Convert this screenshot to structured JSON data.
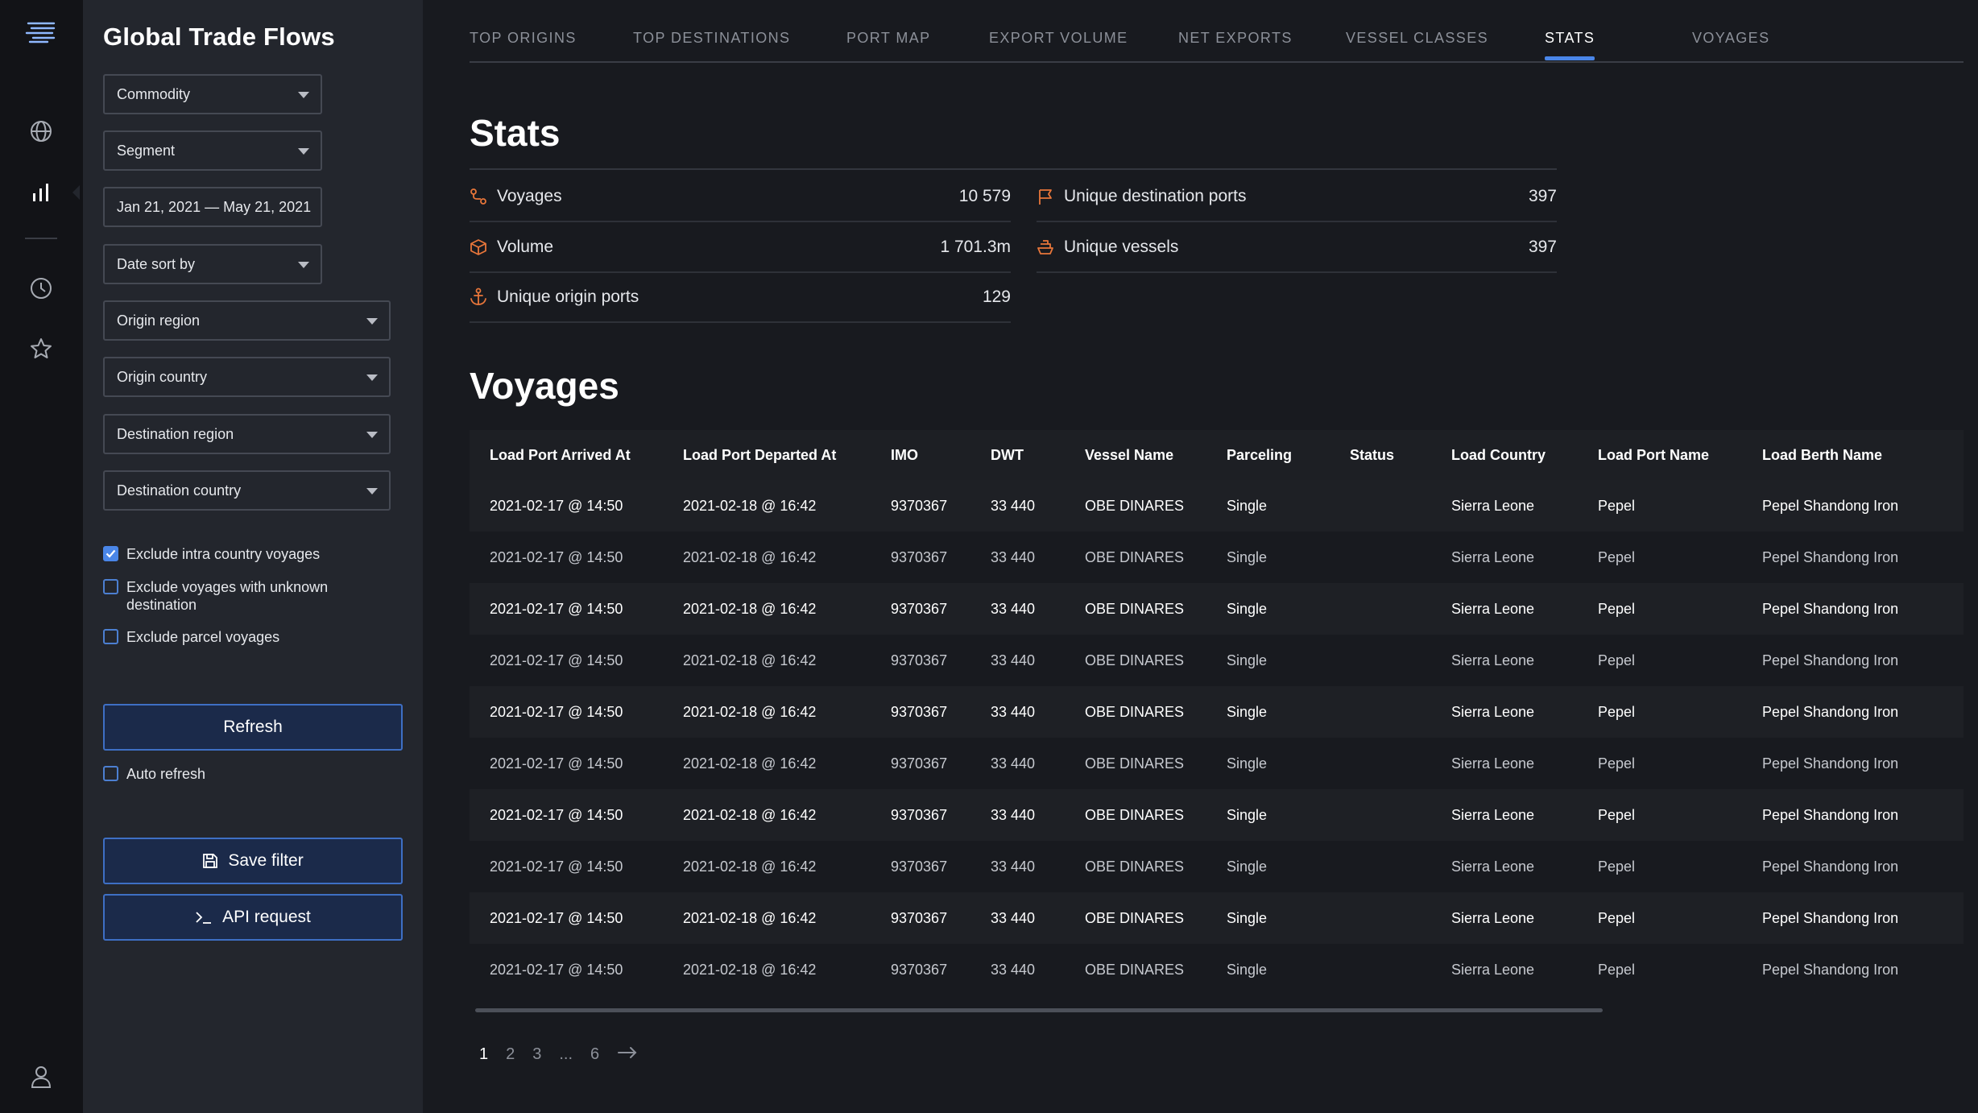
{
  "panel": {
    "title": "Global Trade Flows",
    "fields": {
      "commodity": "Commodity",
      "segment": "Segment",
      "date_range": "Jan 21, 2021 — May 21, 2021",
      "date_sort": "Date sort by",
      "origin_region": "Origin region",
      "origin_country": "Origin country",
      "destination_region": "Destination region",
      "destination_country": "Destination country"
    },
    "checks": {
      "exclude_intra": {
        "label": "Exclude intra country voyages",
        "checked": true
      },
      "exclude_unknown": {
        "label": "Exclude voyages with unknown destination",
        "checked": false
      },
      "exclude_parcel": {
        "label": "Exclude parcel voyages",
        "checked": false
      },
      "auto_refresh": {
        "label": "Auto refresh",
        "checked": false
      }
    },
    "refresh_label": "Refresh",
    "save_filter_label": "Save filter",
    "api_request_label": "API request"
  },
  "tabs": [
    {
      "label": "TOP ORIGINS",
      "active": false
    },
    {
      "label": "TOP DESTINATIONS",
      "active": false
    },
    {
      "label": "PORT MAP",
      "active": false
    },
    {
      "label": "EXPORT VOLUME",
      "active": false
    },
    {
      "label": "NET EXPORTS",
      "active": false
    },
    {
      "label": "VESSEL CLASSES",
      "active": false
    },
    {
      "label": "STATS",
      "active": true
    },
    {
      "label": "VOYAGES",
      "active": false
    }
  ],
  "stats": {
    "heading": "Stats",
    "items": {
      "voyages": {
        "label": "Voyages",
        "value": "10 579"
      },
      "volume": {
        "label": "Volume",
        "value": "1 701.3m"
      },
      "origin_ports": {
        "label": "Unique origin ports",
        "value": "129"
      },
      "dest_ports": {
        "label": "Unique destination ports",
        "value": "397"
      },
      "vessels": {
        "label": "Unique vessels",
        "value": "397"
      }
    }
  },
  "voyages": {
    "heading": "Voyages",
    "columns": [
      "Load Port Arrived At",
      "Load Port Departed At",
      "IMO",
      "DWT",
      "Vessel Name",
      "Parceling",
      "Status",
      "Load Country",
      "Load Port Name",
      "Load Berth Name"
    ],
    "rows": [
      [
        "2021-02-17 @ 14:50",
        "2021-02-18 @ 16:42",
        "9370367",
        "33 440",
        "OBE DINARES",
        "Single",
        "",
        "Sierra Leone",
        "Pepel",
        "Pepel Shandong Iron"
      ],
      [
        "2021-02-17 @ 14:50",
        "2021-02-18 @ 16:42",
        "9370367",
        "33 440",
        "OBE DINARES",
        "Single",
        "",
        "Sierra Leone",
        "Pepel",
        "Pepel Shandong Iron"
      ],
      [
        "2021-02-17 @ 14:50",
        "2021-02-18 @ 16:42",
        "9370367",
        "33 440",
        "OBE DINARES",
        "Single",
        "",
        "Sierra Leone",
        "Pepel",
        "Pepel Shandong Iron"
      ],
      [
        "2021-02-17 @ 14:50",
        "2021-02-18 @ 16:42",
        "9370367",
        "33 440",
        "OBE DINARES",
        "Single",
        "",
        "Sierra Leone",
        "Pepel",
        "Pepel Shandong Iron"
      ],
      [
        "2021-02-17 @ 14:50",
        "2021-02-18 @ 16:42",
        "9370367",
        "33 440",
        "OBE DINARES",
        "Single",
        "",
        "Sierra Leone",
        "Pepel",
        "Pepel Shandong Iron"
      ],
      [
        "2021-02-17 @ 14:50",
        "2021-02-18 @ 16:42",
        "9370367",
        "33 440",
        "OBE DINARES",
        "Single",
        "",
        "Sierra Leone",
        "Pepel",
        "Pepel Shandong Iron"
      ],
      [
        "2021-02-17 @ 14:50",
        "2021-02-18 @ 16:42",
        "9370367",
        "33 440",
        "OBE DINARES",
        "Single",
        "",
        "Sierra Leone",
        "Pepel",
        "Pepel Shandong Iron"
      ],
      [
        "2021-02-17 @ 14:50",
        "2021-02-18 @ 16:42",
        "9370367",
        "33 440",
        "OBE DINARES",
        "Single",
        "",
        "Sierra Leone",
        "Pepel",
        "Pepel Shandong Iron"
      ],
      [
        "2021-02-17 @ 14:50",
        "2021-02-18 @ 16:42",
        "9370367",
        "33 440",
        "OBE DINARES",
        "Single",
        "",
        "Sierra Leone",
        "Pepel",
        "Pepel Shandong Iron"
      ],
      [
        "2021-02-17 @ 14:50",
        "2021-02-18 @ 16:42",
        "9370367",
        "33 440",
        "OBE DINARES",
        "Single",
        "",
        "Sierra Leone",
        "Pepel",
        "Pepel Shandong Iron"
      ]
    ]
  },
  "pagination": {
    "pages": [
      "1",
      "2",
      "3",
      "...",
      "6"
    ],
    "current": "1"
  },
  "colors": {
    "accent": "#4a86e8",
    "stat_icon": "#e8763a",
    "panel_bg": "#23262d",
    "rail_bg": "#121317",
    "main_bg": "#181a1f"
  },
  "icons": {
    "rail": [
      "logo-waves-icon",
      "globe-icon",
      "bar-chart-icon",
      "clock-icon",
      "star-icon",
      "user-icon"
    ],
    "stats": [
      "route-icon",
      "box-icon",
      "anchor-icon",
      "flag-icon",
      "ship-icon"
    ]
  }
}
